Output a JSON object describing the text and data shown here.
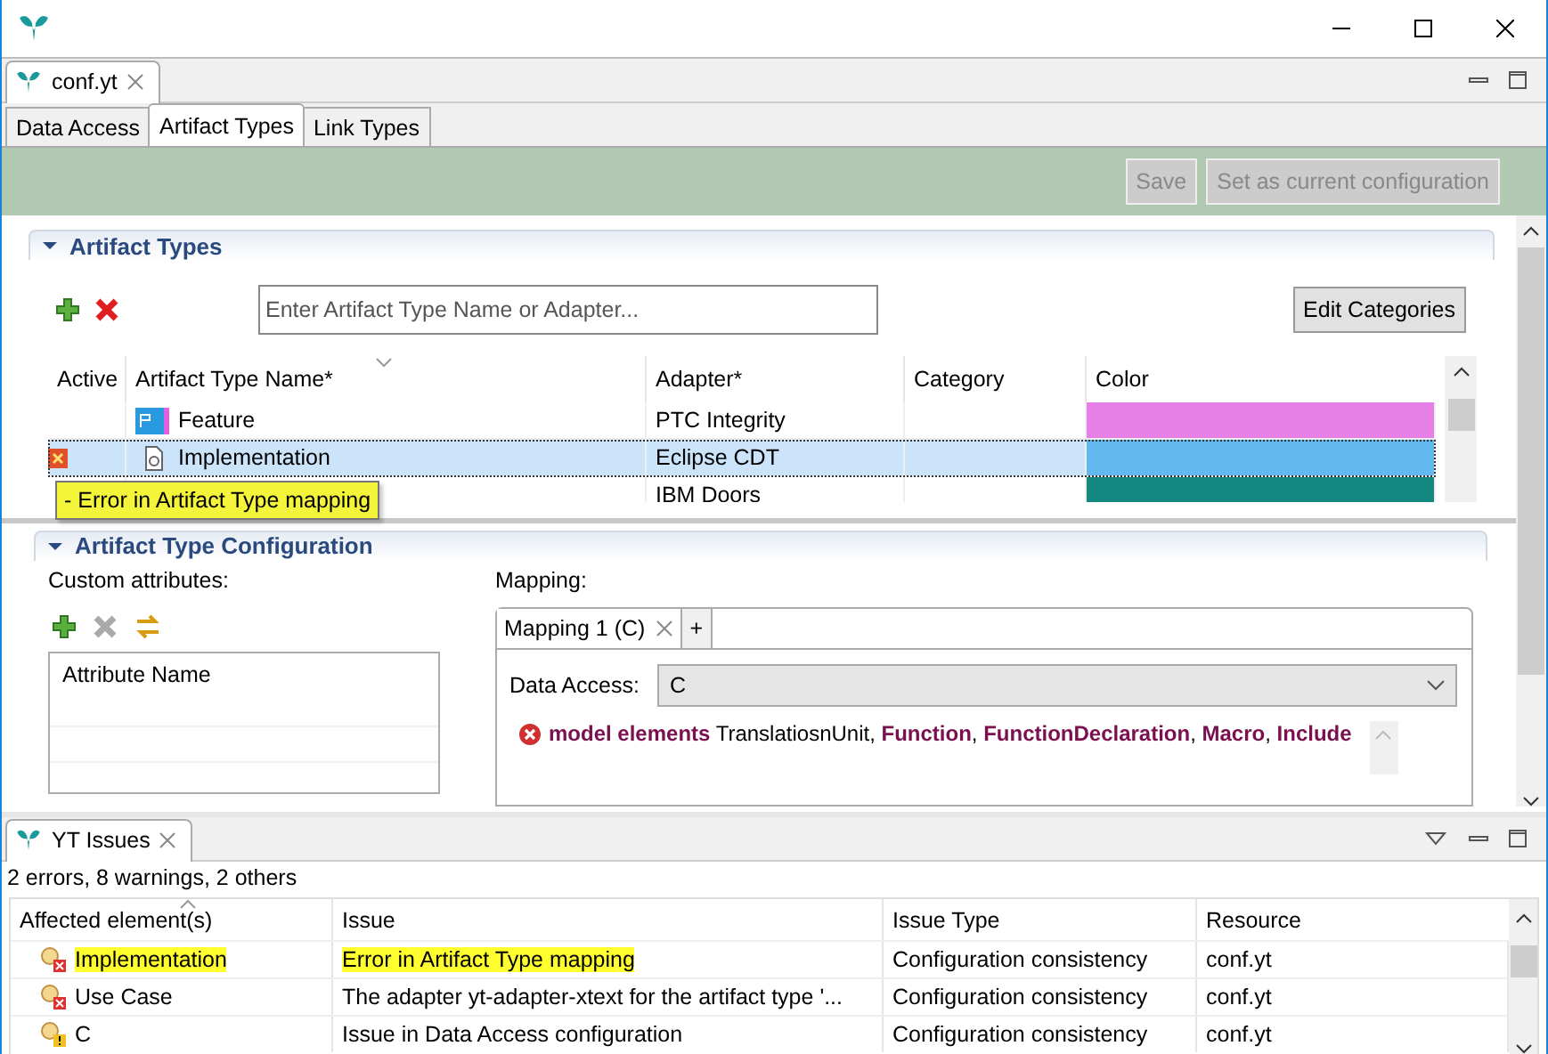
{
  "editor_tab": {
    "label": "conf.yt"
  },
  "page_tabs": [
    {
      "label": "Data Access",
      "selected": false
    },
    {
      "label": "Artifact Types",
      "selected": true
    },
    {
      "label": "Link Types",
      "selected": false
    }
  ],
  "toolbar": {
    "buttons": [
      {
        "label": "Save",
        "disabled": true
      },
      {
        "label": "Set as current configuration",
        "disabled": true
      }
    ]
  },
  "artifact_types": {
    "title": "Artifact Types",
    "expanded": true,
    "search": {
      "placeholder": "Enter Artifact Type Name or Adapter..."
    },
    "edit_button": "Edit Categories",
    "columns": [
      "Active",
      "Artifact Type Name*",
      "Adapter*",
      "Category",
      "Color"
    ],
    "rows": [
      {
        "kind": "ptc",
        "error": false,
        "name": "Feature",
        "adapter": "PTC Integrity",
        "color": "#e680e6",
        "selected": false
      },
      {
        "kind": "file",
        "error": true,
        "name": "Implementation",
        "adapter": "Eclipse CDT",
        "color": "#64b8f0",
        "selected": true
      },
      {
        "kind": "hidden",
        "error": false,
        "adapter": "IBM Doors",
        "color": "#128880",
        "selected": false
      }
    ],
    "tooltip": {
      "text": "- Error in Artifact Type mapping"
    }
  },
  "configuration": {
    "title": "Artifact Type Configuration",
    "expanded": true,
    "attributes_label": "Custom attributes:",
    "attribute_column": "Attribute Name",
    "mapping_label": "Mapping:",
    "mapping_tabs": [
      {
        "label": "Mapping 1 (C)",
        "selected": true,
        "closable": true
      },
      {
        "label": "+",
        "selected": false,
        "closable": false
      }
    ],
    "data_access_label": "Data Access:",
    "data_access_value": "C",
    "message": "**model elements** TranslatiosnUnit, **Function**, **FunctionDeclaration**, **Macro**, **Include**"
  },
  "issues": {
    "title": "YT Issues",
    "summary": "2 errors, 8 warnings, 2 others",
    "columns": [
      "Affected element(s)",
      "Issue",
      "Issue Type",
      "Resource"
    ],
    "rows": [
      {
        "kind": "error",
        "element": "Implementation",
        "issue": "Error in Artifact Type mapping",
        "type": "Configuration consistency",
        "resource": "conf.yt",
        "highlighted": true
      },
      {
        "kind": "error",
        "element": "Use Case",
        "issue": "The adapter yt-adapter-xtext for the artifact type '...",
        "type": "Configuration consistency",
        "resource": "conf.yt",
        "highlighted": false
      },
      {
        "kind": "warning",
        "element": "C",
        "issue": "Issue in Data Access configuration",
        "type": "Configuration consistency",
        "resource": "conf.yt",
        "highlighted": false
      }
    ]
  }
}
